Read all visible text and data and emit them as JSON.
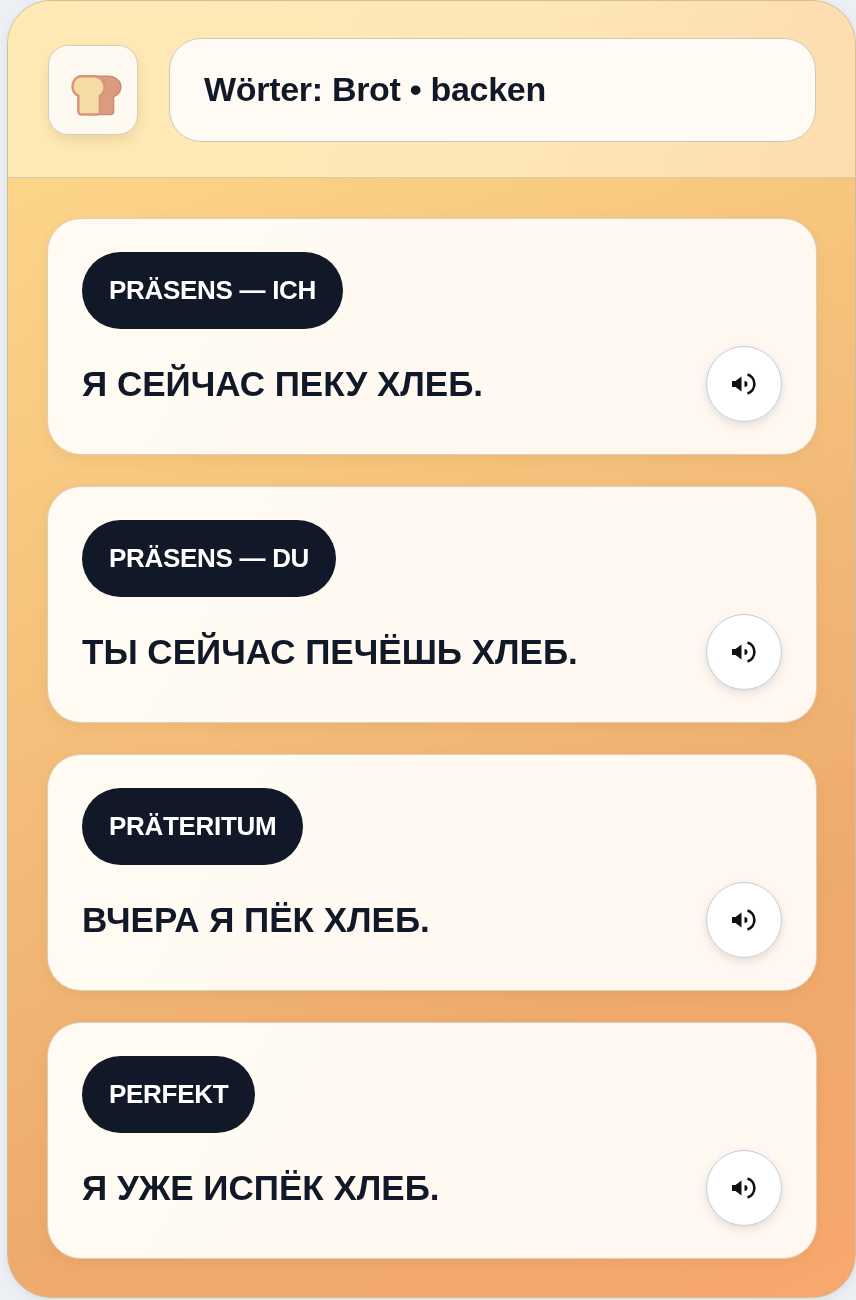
{
  "header": {
    "title": "Wörter: Brot • backen"
  },
  "cards": [
    {
      "tense": "PRÄSENS — ICH",
      "sentence": "Я СЕЙЧАС ПЕКУ ХЛЕБ."
    },
    {
      "tense": "PRÄSENS — DU",
      "sentence": "ТЫ СЕЙЧАС ПЕЧЁШЬ ХЛЕБ."
    },
    {
      "tense": "PRÄTERITUM",
      "sentence": "ВЧЕРА Я ПЁК ХЛЕБ."
    },
    {
      "tense": "PERFEKT",
      "sentence": "Я УЖЕ ИСПЁК ХЛЕБ."
    }
  ]
}
